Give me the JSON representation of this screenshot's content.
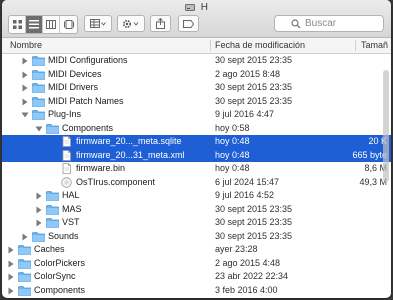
{
  "window": {
    "title": "H"
  },
  "toolbar": {
    "search_placeholder": "Buscar"
  },
  "columns": {
    "name": "Nombre",
    "date": "Fecha de modificación",
    "size": "Tamañ"
  },
  "rows": [
    {
      "indent": 2,
      "disclosure": "closed",
      "icon": "folder",
      "name": "MIDI Configurations",
      "date": "30 sept 2015 23:35",
      "size": ""
    },
    {
      "indent": 2,
      "disclosure": "closed",
      "icon": "folder",
      "name": "MIDI Devices",
      "date": "2 ago 2015 8:48",
      "size": ""
    },
    {
      "indent": 2,
      "disclosure": "closed",
      "icon": "folder",
      "name": "MIDI Drivers",
      "date": "30 sept 2015 23:35",
      "size": ""
    },
    {
      "indent": 2,
      "disclosure": "closed",
      "icon": "folder",
      "name": "MIDI Patch Names",
      "date": "30 sept 2015 23:35",
      "size": ""
    },
    {
      "indent": 2,
      "disclosure": "open",
      "icon": "folder",
      "name": "Plug-Ins",
      "date": "9 jul 2016 4:47",
      "size": ""
    },
    {
      "indent": 3,
      "disclosure": "open",
      "icon": "folder",
      "name": "Components",
      "date": "hoy 0:58",
      "size": ""
    },
    {
      "indent": 4,
      "disclosure": "none",
      "icon": "doc",
      "name": "firmware_20..._meta.sqlite",
      "date": "hoy 0:48",
      "size": "20 K",
      "selected": true
    },
    {
      "indent": 4,
      "disclosure": "none",
      "icon": "doc",
      "name": "firmware_20...31_meta.xml",
      "date": "hoy 0:48",
      "size": "665 byte",
      "selected": true
    },
    {
      "indent": 4,
      "disclosure": "none",
      "icon": "doc",
      "name": "firmware.bin",
      "date": "hoy 0:48",
      "size": "8,6 M",
      "selected": false
    },
    {
      "indent": 4,
      "disclosure": "none",
      "icon": "component",
      "name": "OsTIrus.component",
      "date": "6 jul 2024 15:47",
      "size": "49,3 M"
    },
    {
      "indent": 3,
      "disclosure": "closed",
      "icon": "folder",
      "name": "HAL",
      "date": "9 jul 2016 4:52",
      "size": ""
    },
    {
      "indent": 3,
      "disclosure": "closed",
      "icon": "folder",
      "name": "MAS",
      "date": "30 sept 2015 23:35",
      "size": ""
    },
    {
      "indent": 3,
      "disclosure": "closed",
      "icon": "folder",
      "name": "VST",
      "date": "30 sept 2015 23:35",
      "size": ""
    },
    {
      "indent": 2,
      "disclosure": "closed",
      "icon": "folder",
      "name": "Sounds",
      "date": "30 sept 2015 23:35",
      "size": ""
    },
    {
      "indent": 1,
      "disclosure": "closed",
      "icon": "folder",
      "name": "Caches",
      "date": "ayer 23:28",
      "size": ""
    },
    {
      "indent": 1,
      "disclosure": "closed",
      "icon": "folder",
      "name": "ColorPickers",
      "date": "2 ago 2015 4:48",
      "size": ""
    },
    {
      "indent": 1,
      "disclosure": "closed",
      "icon": "folder",
      "name": "ColorSync",
      "date": "23 abr 2022 22:34",
      "size": ""
    },
    {
      "indent": 1,
      "disclosure": "closed",
      "icon": "folder",
      "name": "Components",
      "date": "3 feb 2016 4:00",
      "size": ""
    }
  ]
}
